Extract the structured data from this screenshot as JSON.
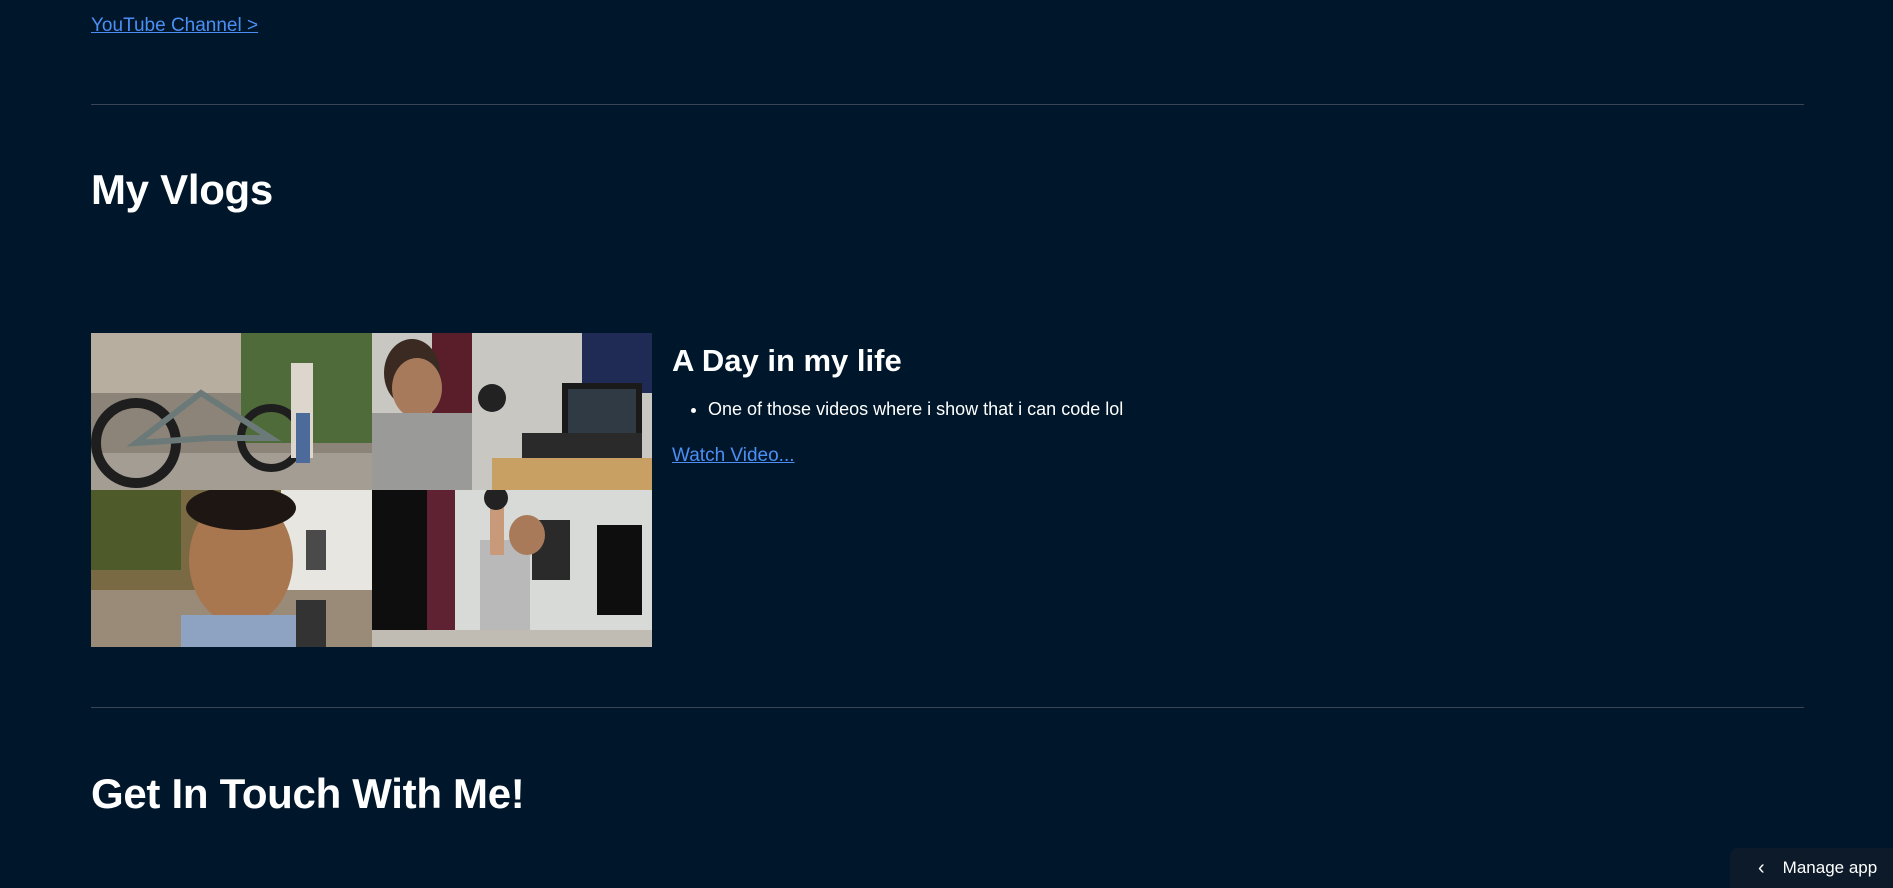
{
  "links": {
    "youtube_channel": "YouTube Channel >"
  },
  "vlogs": {
    "section_title": "My Vlogs",
    "video": {
      "title": "A Day in my life",
      "bullets": [
        "One of those videos where i show that i can code lol"
      ],
      "watch_label": "Watch Video..."
    }
  },
  "contact": {
    "section_title": "Get In Touch With Me!"
  },
  "manage_app": {
    "label": "Manage app",
    "icon": "chevron-left-icon"
  },
  "colors": {
    "background": "#00172b",
    "link": "#4b8ff4",
    "divider": "#3a4656"
  }
}
